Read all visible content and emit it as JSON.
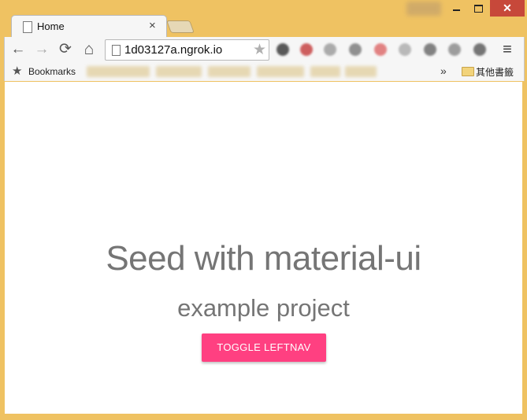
{
  "window": {
    "close_glyph": "✕"
  },
  "tab": {
    "title": "Home",
    "close_glyph": "×"
  },
  "toolbar": {
    "back_glyph": "←",
    "forward_glyph": "→",
    "reload_glyph": "⟳",
    "home_glyph": "⌂",
    "url": "1d03127a.ngrok.io",
    "star_glyph": "★",
    "menu_glyph": "≡"
  },
  "bookmarks_bar": {
    "star_glyph": "★",
    "label": "Bookmarks",
    "overflow_glyph": "»",
    "other_bookmarks": "其他書籤"
  },
  "page": {
    "headline": "Seed with material-ui",
    "subheadline": "example project",
    "toggle_button": "TOGGLE LEFTNAV",
    "accent_color": "#ff4081",
    "text_color": "#757575"
  },
  "icons": [
    "page-icon",
    "close-icon",
    "back-icon",
    "forward-icon",
    "reload-icon",
    "home-icon",
    "star-icon",
    "menu-icon",
    "folder-icon"
  ]
}
